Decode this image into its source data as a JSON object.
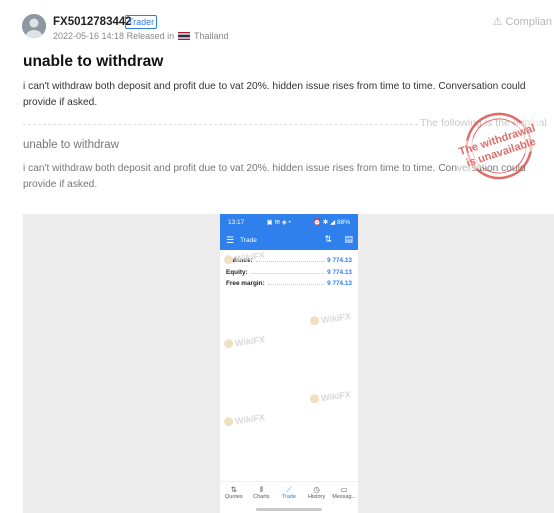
{
  "post": {
    "username": "FX5012783442",
    "badge": "Trader",
    "date": "2022-05-16 14:18",
    "released_in": "Released in",
    "country": "Thailand",
    "complain_label": "Complian",
    "title": "unable to withdraw",
    "body": "i can't withdraw both deposit and profit due to vat 20%. hidden issue rises from time to time. Conversation could provide if asked.",
    "following_label": "The following is the original",
    "original_title": "unable to withdraw",
    "original_body": "i can't withdraw both deposit and profit due to vat 20%. hidden issue rises from time to time. Conversation could provide if asked.",
    "stamp_line1": "The withdrawal",
    "stamp_line2": "is unavailable"
  },
  "phone": {
    "status_time": "13:17",
    "battery": "88%",
    "screen_title": "Trade",
    "account": [
      {
        "label": "Balance:",
        "value": "9 774.13"
      },
      {
        "label": "Equity:",
        "value": "9 774.13"
      },
      {
        "label": "Free margin:",
        "value": "9 774.13"
      }
    ],
    "watermark": "WikiFX",
    "nav": [
      {
        "label": "Quotes",
        "icon": "quotes-icon"
      },
      {
        "label": "Charts",
        "icon": "charts-icon"
      },
      {
        "label": "Trade",
        "icon": "trade-icon"
      },
      {
        "label": "History",
        "icon": "history-icon"
      },
      {
        "label": "Messag...",
        "icon": "messages-icon"
      }
    ]
  },
  "colors": {
    "accent": "#2f80ed",
    "badge": "#2f7de1",
    "stamp": "#d9534f"
  }
}
